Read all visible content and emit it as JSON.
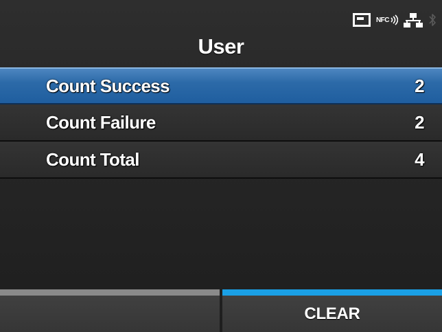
{
  "status": {
    "icons": [
      "sd-card-icon",
      "nfc-icon",
      "network-icon",
      "bluetooth-icon"
    ],
    "nfc_label": "NFC"
  },
  "title": "User",
  "menu": {
    "items": [
      {
        "label": "Count Success",
        "value": "2",
        "selected": true
      },
      {
        "label": "Count Failure",
        "value": "2",
        "selected": false
      },
      {
        "label": "Count Total",
        "value": "4",
        "selected": false
      }
    ]
  },
  "softkeys": {
    "left_label": "",
    "right_label": "CLEAR"
  },
  "colors": {
    "selection": "#1f5e9f",
    "softkey_accent": "#1aa0e6",
    "softkey_inactive": "#8a8a8a"
  }
}
